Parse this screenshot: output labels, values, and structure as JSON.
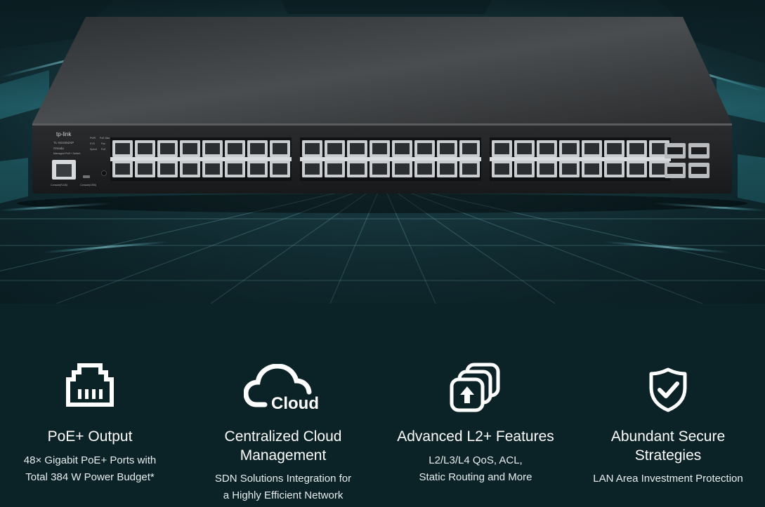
{
  "product": {
    "brand": "tp-link",
    "model": "TL-SG3452XP",
    "subtitle": "Managed PoE+ Switch",
    "omada_label": "Omada",
    "console_rj45_label": "Console(RJ45)",
    "console_usb_label": "Console(USB)",
    "led_labels": [
      "PWR",
      "PoE Max",
      "SYS",
      "Fan",
      "Speed",
      "PoE"
    ],
    "port_count": 48,
    "sfp_count": 4
  },
  "features": [
    {
      "icon": "ethernet-port-icon",
      "title": "PoE+ Output",
      "desc_lines": [
        "48× Gigabit PoE+ Ports with",
        "Total 384 W Power Budget*"
      ]
    },
    {
      "icon": "cloud-icon",
      "icon_text": "Cloud",
      "title_lines": [
        "Centralized Cloud",
        "Management"
      ],
      "desc_lines": [
        "SDN Solutions Integration for",
        "a Highly Efficient Network"
      ]
    },
    {
      "icon": "layers-arrow-icon",
      "title": "Advanced L2+ Features",
      "desc_lines": [
        "L2/L3/L4 QoS, ACL,",
        "Static Routing and More"
      ]
    },
    {
      "icon": "shield-check-icon",
      "title_lines": [
        "Abundant Secure",
        "Strategies"
      ],
      "desc_lines": [
        "LAN Area Investment Protection"
      ]
    }
  ],
  "colors": {
    "background": "#0b2327",
    "text": "#ffffff"
  }
}
